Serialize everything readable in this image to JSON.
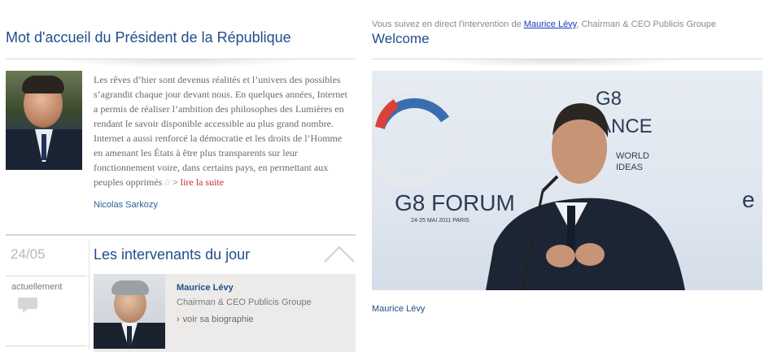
{
  "left": {
    "heading": "Mot d'accueil du Président de la République",
    "quote_text": "Les rêves d’hier sont devenus réalités et l’univers des possibles s’agrandit chaque jour devant nous. En quelques années, Internet a permis de réaliser l’ambition des philosophes des Lumières en rendant le savoir disponible accessible au plus grand nombre. Internet a aussi renforcé la démocratie et les droits de l’Homme en amenant les États à être plus transparents sur leur fonctionnement voire, dans certains pays, en permettant aux peuples opprimés",
    "quote_sep": "//",
    "read_more": "> lire la suite",
    "signature": "Nicolas Sarkozy",
    "date": "24/05",
    "speakers_heading": "Les intervenants du jour",
    "now_label": "actuellement",
    "speaker": {
      "name": "Maurice Lévy",
      "role": "Chairman & CEO Publicis Groupe",
      "bio_link": "voir sa biographie",
      "bio_arrow": "›"
    }
  },
  "right": {
    "live_prefix": "Vous suivez en direct l'intervention de ",
    "live_name": "Maurice Lévy",
    "live_suffix": ", Chairman & CEO Publicis Groupe",
    "heading": "Welcome",
    "video_texts": {
      "forum": "G8 FORUM",
      "dates": "24-25 MAI 2011 PARIS",
      "france": "ANCE",
      "g8": "G8",
      "world": "WORLD",
      "ideas": "IDEAS"
    },
    "caption": "Maurice Lévy"
  },
  "colors": {
    "heading_blue": "#1f4f8a",
    "link_red": "#c0302e",
    "card_bg": "#ecebe9"
  }
}
